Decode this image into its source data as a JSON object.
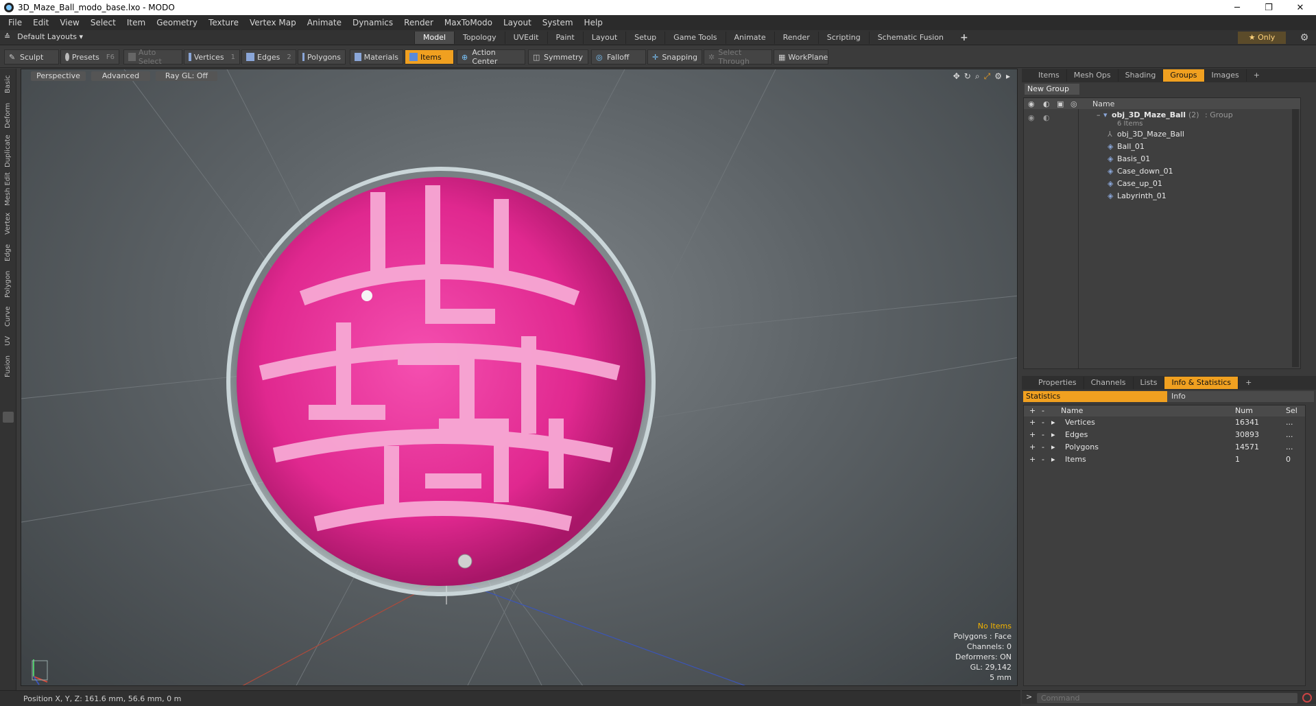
{
  "window": {
    "title": "3D_Maze_Ball_modo_base.lxo - MODO",
    "minimize": "─",
    "maximize": "❐",
    "close": "✕"
  },
  "menu": [
    "File",
    "Edit",
    "View",
    "Select",
    "Item",
    "Geometry",
    "Texture",
    "Vertex Map",
    "Animate",
    "Dynamics",
    "Render",
    "MaxToModo",
    "Layout",
    "System",
    "Help"
  ],
  "layout": {
    "name": "Default Layouts",
    "tabs": [
      "Model",
      "Topology",
      "UVEdit",
      "Paint",
      "Layout",
      "Setup",
      "Game Tools",
      "Animate",
      "Render",
      "Scripting",
      "Schematic Fusion"
    ],
    "active_tab": "Model",
    "only": "★ Only"
  },
  "toolbar": {
    "sculpt": "Sculpt",
    "presets": "Presets",
    "presets_key": "F6",
    "auto_select": "Auto Select",
    "vertices": "Vertices",
    "vertices_key": "1",
    "edges": "Edges",
    "edges_key": "2",
    "polygons": "Polygons",
    "materials": "Materials",
    "items": "Items",
    "action_center": "Action Center",
    "symmetry": "Symmetry",
    "falloff": "Falloff",
    "snapping": "Snapping",
    "select_through": "Select Through",
    "workplane": "WorkPlane"
  },
  "left_tabs": [
    "Basic",
    "Deform",
    "Duplicate",
    "Mesh Edit",
    "Vertex",
    "Edge",
    "Polygon",
    "Curve",
    "UV",
    "Fusion"
  ],
  "viewport": {
    "perspective": "Perspective",
    "advanced": "Advanced",
    "raygl": "Ray GL: Off",
    "overlay": {
      "no_items": "No Items",
      "polygons": "Polygons : Face",
      "channels": "Channels: 0",
      "deformers": "Deformers: ON",
      "gl": "GL: 29,142",
      "scale": "5 mm"
    }
  },
  "groups_panel": {
    "tabs": [
      "Items",
      "Mesh Ops",
      "Shading",
      "Groups",
      "Images"
    ],
    "active": "Groups",
    "new_group": "New Group",
    "col_name": "Name",
    "group_name": "obj_3D_Maze_Ball",
    "group_count": "(2)",
    "group_type": ": Group",
    "group_sub": "6 Items",
    "items": [
      "obj_3D_Maze_Ball",
      "Ball_01",
      "Basis_01",
      "Case_down_01",
      "Case_up_01",
      "Labyrinth_01"
    ]
  },
  "stats_panel": {
    "tabs": [
      "Properties",
      "Channels",
      "Lists",
      "Info & Statistics"
    ],
    "active": "Info & Statistics",
    "sub_statistics": "Statistics",
    "sub_info": "Info",
    "cols": {
      "name": "Name",
      "num": "Num",
      "sel": "Sel"
    },
    "rows": [
      {
        "name": "Vertices",
        "num": "16341",
        "sel": "..."
      },
      {
        "name": "Edges",
        "num": "30893",
        "sel": "..."
      },
      {
        "name": "Polygons",
        "num": "14571",
        "sel": "..."
      },
      {
        "name": "Items",
        "num": "1",
        "sel": "0"
      }
    ]
  },
  "status": {
    "position": "Position X, Y, Z:   161.6 mm, 56.6 mm, 0 m"
  },
  "command": {
    "placeholder": "Command"
  }
}
